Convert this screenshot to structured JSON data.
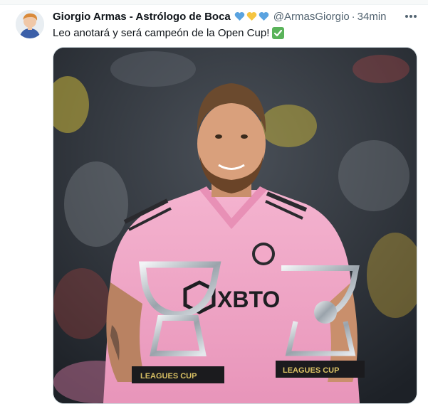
{
  "tweet": {
    "author_name": "Giorgio Armas - Astrólogo de Boca",
    "name_emojis": [
      "blue-heart",
      "yellow-heart",
      "blue-heart"
    ],
    "handle": "@ArmasGiorgio",
    "separator": "·",
    "time": "34min",
    "text": "Leo anotará y será campeón de la Open Cup!",
    "text_emoji": "check-mark-button"
  },
  "colors": {
    "blue_heart": "#5aa3e0",
    "yellow_heart": "#f5c542",
    "check_green": "#5ab35a",
    "jersey_pink": "#f2a9c8"
  },
  "media": {
    "kind": "photo",
    "jersey_text": "XBTO",
    "trophy_label": "LEAGUES CUP"
  }
}
